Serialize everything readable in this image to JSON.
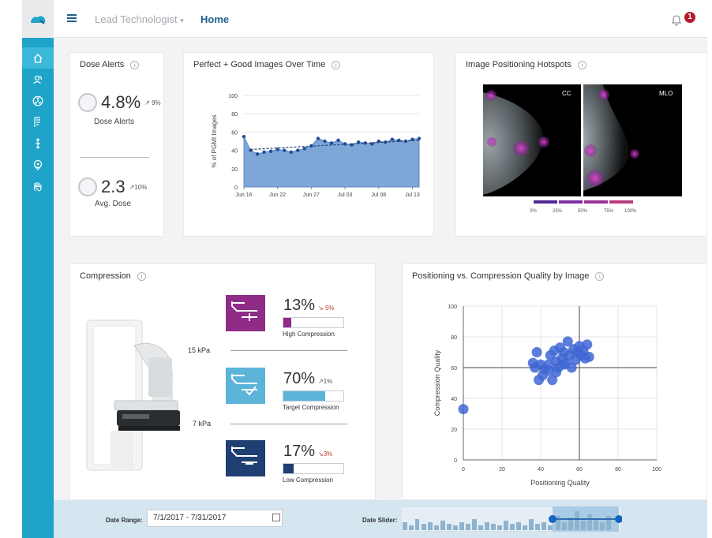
{
  "header": {
    "role": "Lead Technologist",
    "role_caret": "▾",
    "page": "Home",
    "notifications": "1"
  },
  "sidebar": {
    "items": [
      "home-icon",
      "users-icon",
      "radiation-icon",
      "reports-icon",
      "transfer-icon",
      "location-icon",
      "hand-icon"
    ],
    "active": 0
  },
  "colors": {
    "accent": "#1ea4c9",
    "header_link": "#1f5f8a",
    "high": "#8e2c87",
    "target": "#5cb4d9",
    "low": "#1f3f73",
    "chart_fill": "#7ea6d6",
    "scatter": "#3f66d3"
  },
  "dose_alerts": {
    "title": "Dose Alerts",
    "info": "i",
    "pct_value": "4.8%",
    "pct_trend": "↗ 9%",
    "pct_label": "Dose Alerts",
    "avg_value": "2.3",
    "avg_trend": "↗10%",
    "avg_label": "Avg. Dose"
  },
  "pgmi_card": {
    "title": "Perfect + Good Images Over Time",
    "info": "i"
  },
  "hotspots_card": {
    "title": "Image Positioning Hotspots",
    "info": "i",
    "view_left": "CC",
    "view_right": "MLO",
    "scale_labels": [
      "0%",
      "25%",
      "50%",
      "75%",
      "100%"
    ],
    "scale_colors": [
      "#4f2a94",
      "#7b2fa0",
      "#9a3296",
      "#b83a7e"
    ]
  },
  "compression": {
    "title": "Compression",
    "info": "i",
    "kpa_high": "15 kPa",
    "kpa_low": "7 kPa",
    "high": {
      "pct": "13%",
      "trend": "↘ 5%",
      "label": "High Compression",
      "fill": 0.13
    },
    "target": {
      "pct": "70%",
      "trend": "↗1%",
      "label": "Target Compression",
      "fill": 0.7
    },
    "low": {
      "pct": "17%",
      "trend": "↘3%",
      "label": "Low Compression",
      "fill": 0.17
    }
  },
  "scatter_card": {
    "title": "Positioning vs. Compression Quality by Image",
    "info": "i"
  },
  "footer": {
    "date_range_label": "Date Range:",
    "date_range_value": "7/1/2017 - 7/31/2017",
    "date_slider_label": "Date Slider:"
  },
  "chart_data": [
    {
      "type": "area",
      "title": "Perfect + Good Images Over Time",
      "ylabel": "% of PGMI Images",
      "xlabel": "",
      "ylim": [
        0,
        100
      ],
      "yticks": [
        0,
        20,
        40,
        60,
        80,
        100
      ],
      "xtick_labels": [
        "Jun 16",
        "Jun 22",
        "Jun 27",
        "Jul 03",
        "Jul 08",
        "Jul 13"
      ],
      "xtick_index": [
        0,
        5,
        10,
        15,
        20,
        25
      ],
      "series": [
        {
          "values": [
            55,
            40,
            36,
            38,
            39,
            41,
            40,
            38,
            40,
            42,
            45,
            53,
            50,
            48,
            51,
            47,
            46,
            49,
            48,
            47,
            50,
            49,
            52,
            51,
            50,
            52,
            53
          ]
        }
      ],
      "trend": [
        41,
        51
      ],
      "grid": true
    },
    {
      "type": "scatter",
      "title": "Positioning vs. Compression Quality by Image",
      "xlabel": "Positioning Quality",
      "ylabel": "Compression Quality",
      "xlim": [
        0,
        100
      ],
      "ylim": [
        0,
        100
      ],
      "xticks": [
        0,
        20,
        40,
        60,
        80,
        100
      ],
      "yticks": [
        0,
        20,
        40,
        60,
        80,
        100
      ],
      "reference_lines": {
        "x": 60,
        "y": 60
      },
      "points": [
        [
          0,
          33
        ],
        [
          36,
          63
        ],
        [
          38,
          70
        ],
        [
          37,
          60
        ],
        [
          39,
          52
        ],
        [
          41,
          55
        ],
        [
          42,
          59
        ],
        [
          44,
          62
        ],
        [
          45,
          68
        ],
        [
          46,
          52
        ],
        [
          47,
          71
        ],
        [
          48,
          64
        ],
        [
          49,
          60
        ],
        [
          50,
          73
        ],
        [
          51,
          66
        ],
        [
          52,
          70
        ],
        [
          53,
          63
        ],
        [
          54,
          77
        ],
        [
          55,
          68
        ],
        [
          56,
          60
        ],
        [
          57,
          72
        ],
        [
          58,
          65
        ],
        [
          59,
          70
        ],
        [
          60,
          74
        ],
        [
          61,
          68
        ],
        [
          62,
          71
        ],
        [
          63,
          66
        ],
        [
          64,
          75
        ],
        [
          65,
          67
        ],
        [
          44,
          58
        ],
        [
          40,
          62
        ],
        [
          48,
          57
        ],
        [
          52,
          62
        ]
      ],
      "grid": true
    }
  ]
}
